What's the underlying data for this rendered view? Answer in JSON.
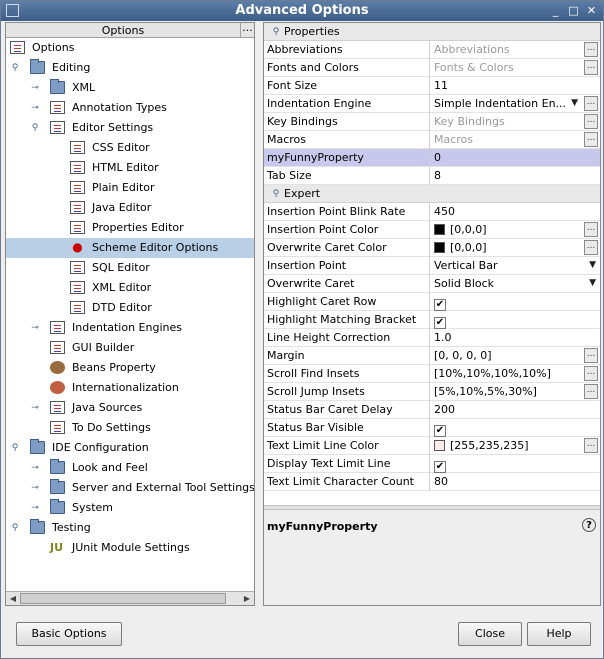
{
  "window": {
    "title": "Advanced Options"
  },
  "tree": {
    "header": "Options",
    "more": "...",
    "items": [
      {
        "label": "Options"
      },
      {
        "label": "Editing"
      },
      {
        "label": "XML"
      },
      {
        "label": "Annotation Types"
      },
      {
        "label": "Editor Settings"
      },
      {
        "label": "CSS Editor"
      },
      {
        "label": "HTML Editor"
      },
      {
        "label": "Plain Editor"
      },
      {
        "label": "Java Editor"
      },
      {
        "label": "Properties Editor"
      },
      {
        "label": "Scheme Editor Options"
      },
      {
        "label": "SQL Editor"
      },
      {
        "label": "XML Editor"
      },
      {
        "label": "DTD Editor"
      },
      {
        "label": "Indentation Engines"
      },
      {
        "label": "GUI Builder"
      },
      {
        "label": "Beans Property"
      },
      {
        "label": "Internationalization"
      },
      {
        "label": "Java Sources"
      },
      {
        "label": "To Do Settings"
      },
      {
        "label": "IDE Configuration"
      },
      {
        "label": "Look and Feel"
      },
      {
        "label": "Server and External Tool Settings"
      },
      {
        "label": "System"
      },
      {
        "label": "Testing"
      },
      {
        "label": "JUnit Module Settings"
      }
    ]
  },
  "properties": {
    "category_properties": "Properties",
    "category_expert": "Expert",
    "rows": [
      {
        "name": "Abbreviations",
        "value": "Abbreviations"
      },
      {
        "name": "Fonts and Colors",
        "value": "Fonts & Colors"
      },
      {
        "name": "Font Size",
        "value": "11"
      },
      {
        "name": "Indentation Engine",
        "value": "Simple Indentation En..."
      },
      {
        "name": "Key Bindings",
        "value": "Key Bindings"
      },
      {
        "name": "Macros",
        "value": "Macros"
      },
      {
        "name": "myFunnyProperty",
        "value": "0"
      },
      {
        "name": "Tab Size",
        "value": "8"
      }
    ],
    "expert": [
      {
        "name": "Insertion Point Blink Rate",
        "value": "450"
      },
      {
        "name": "Insertion Point Color",
        "value": "[0,0,0]",
        "color": "#000000"
      },
      {
        "name": "Overwrite Caret Color",
        "value": "[0,0,0]",
        "color": "#000000"
      },
      {
        "name": "Insertion Point",
        "value": "Vertical Bar"
      },
      {
        "name": "Overwrite Caret",
        "value": "Solid Block"
      },
      {
        "name": "Highlight Caret Row",
        "value": "✔"
      },
      {
        "name": "Highlight Matching Bracket",
        "value": "✔"
      },
      {
        "name": "Line Height Correction",
        "value": "1.0"
      },
      {
        "name": "Margin",
        "value": "[0, 0, 0, 0]"
      },
      {
        "name": "Scroll Find Insets",
        "value": "[10%,10%,10%,10%]"
      },
      {
        "name": "Scroll Jump Insets",
        "value": "[5%,10%,5%,30%]"
      },
      {
        "name": "Status Bar Caret Delay",
        "value": "200"
      },
      {
        "name": "Status Bar Visible",
        "value": "✔"
      },
      {
        "name": "Text Limit Line Color",
        "value": "[255,235,235]",
        "color": "#ffebeb"
      },
      {
        "name": "Display Text Limit Line",
        "value": "✔"
      },
      {
        "name": "Text Limit Character Count",
        "value": "80"
      }
    ],
    "description_name": "myFunnyProperty",
    "help_icon": "?"
  },
  "buttons": {
    "basic": "Basic Options",
    "close": "Close",
    "help": "Help"
  },
  "colors": {
    "title_bar": "#4a6b94",
    "selection": "#b8cfe5",
    "property_selection": "#c8c8ec"
  }
}
